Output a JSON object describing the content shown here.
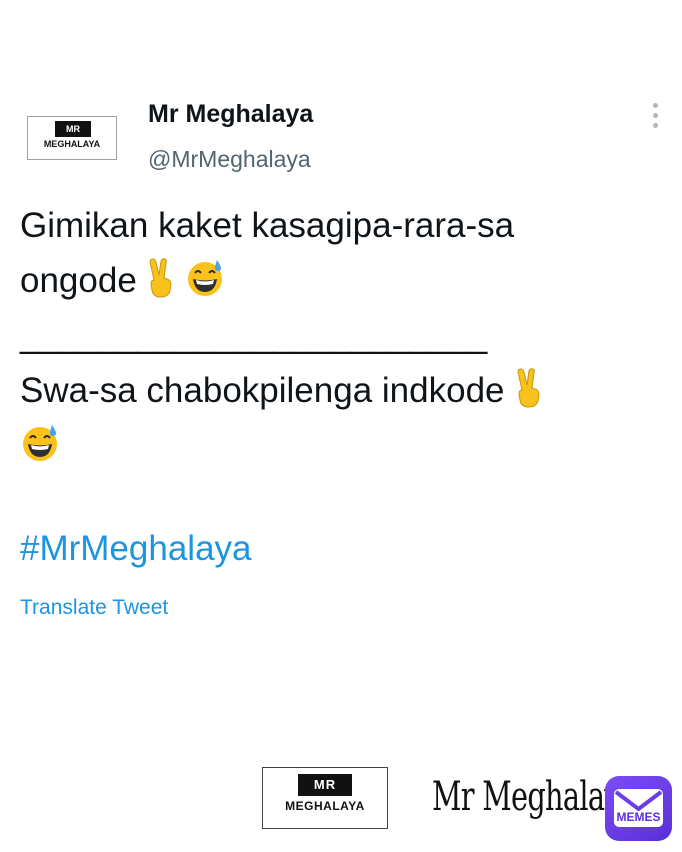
{
  "tweet": {
    "avatar": {
      "box_text": "MR",
      "name_text": "MEGHALAYA"
    },
    "display_name": "Mr Meghalaya",
    "handle": "@MrMeghalaya",
    "more_icon": "more-vertical-icon",
    "body_lines": [
      "Gimikan kaket kasagipa-rara-sa",
      "ongode",
      "________________________",
      "Swa-sa chabokpilenga indkode",
      ""
    ],
    "emojis": [
      "victory-hand-icon",
      "grinning-sweat-icon"
    ],
    "hashtag": "#MrMeghalaya",
    "translate_label": "Translate Tweet"
  },
  "footer": {
    "logo": {
      "box_text": "MR",
      "name_text": "MEGHALAYA"
    },
    "signature": "Mr Meghalaya",
    "badge_text": "MEMES"
  },
  "colors": {
    "link": "#1b95e0",
    "text": "#0f1419",
    "muted": "#536471",
    "badge": "#6a3ee6"
  }
}
